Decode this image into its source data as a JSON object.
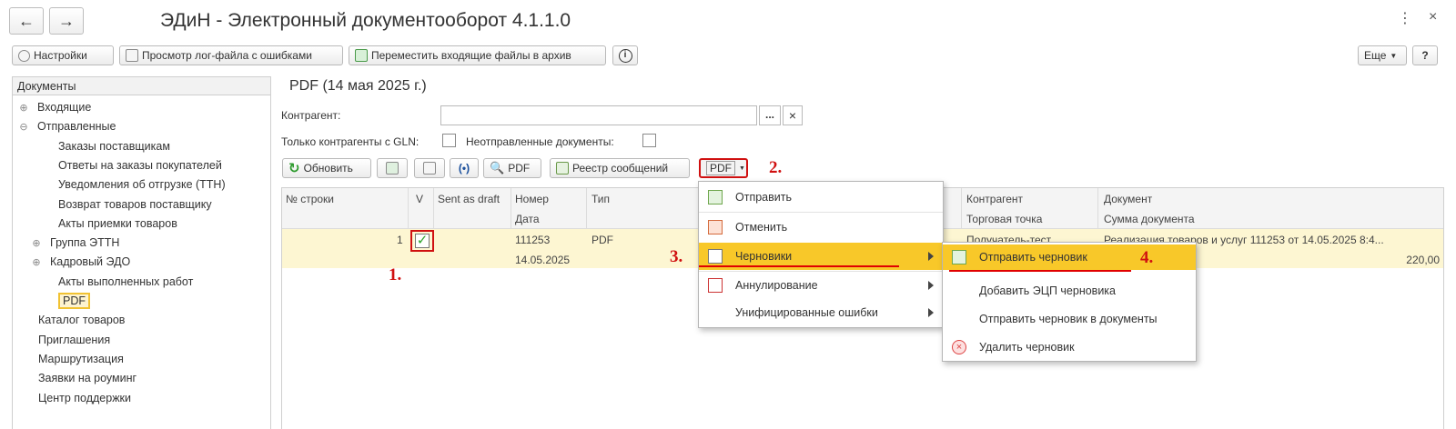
{
  "window": {
    "title": "ЭДиН - Электронный документооборот 4.1.1.0"
  },
  "nav": {
    "back_icon": "arrow-left-icon",
    "forward_icon": "arrow-right-icon"
  },
  "toolbar": {
    "settings": "Настройки",
    "view_log": "Просмотр лог-файла с ошибками",
    "move_archive": "Переместить входящие файлы в архив",
    "more": "Еще",
    "help": "?"
  },
  "sidebar": {
    "header": "Документы",
    "items": [
      {
        "label": "Входящие",
        "glyph": "⊕"
      },
      {
        "label": "Отправленные",
        "glyph": "⊖"
      },
      {
        "label": "Заказы поставщикам"
      },
      {
        "label": "Ответы на заказы покупателей"
      },
      {
        "label": "Уведомления об отгрузке (ТТН)"
      },
      {
        "label": "Возврат товаров поставщику"
      },
      {
        "label": "Акты приемки товаров"
      },
      {
        "label": "Группа ЭТТН",
        "glyph": "⊕"
      },
      {
        "label": "Кадровый ЭДО",
        "glyph": "⊕"
      },
      {
        "label": "Акты выполненных работ"
      },
      {
        "label": "PDF"
      },
      {
        "label": "Каталог товаров"
      },
      {
        "label": "Приглашения"
      },
      {
        "label": "Маршрутизация"
      },
      {
        "label": "Заявки на роуминг"
      },
      {
        "label": "Центр поддержки"
      }
    ]
  },
  "main": {
    "title": "PDF (14 мая 2025 г.)",
    "counterparty_label": "Контрагент:",
    "counterparty_value": "",
    "select_btn": "...",
    "clear_btn": "×",
    "gln_label": "Только контрагенты с GLN:",
    "unsent_label": "Неотправленные документы:",
    "refresh": "Обновить",
    "broadcast": "(•)",
    "pdf_view": "PDF",
    "registry": "Реестр сообщений",
    "pdf_dropdown": "PDF"
  },
  "table": {
    "headers_row1": [
      "№ строки",
      "V",
      "Sent as draft",
      "Номер",
      "Тип",
      "Контрагент",
      "Документ"
    ],
    "headers_row2": [
      "Дата",
      "Торговая точка",
      "Сумма документа"
    ],
    "row": {
      "line_no": "1",
      "number": "111253",
      "date": "14.05.2025",
      "type": "PDF",
      "counterparty": "Получатель-тест",
      "document": "Реализация товаров и услуг 111253 от 14.05.2025 8:4...",
      "amount": "220,00"
    }
  },
  "menu1": {
    "items": [
      "Отправить",
      "Отменить",
      "Черновики",
      "Аннулирование",
      "Унифицированные ошибки"
    ]
  },
  "menu2": {
    "items": [
      "Отправить черновик",
      "Добавить ЭЦП черновика",
      "Отправить черновик в документы",
      "Удалить черновик"
    ]
  },
  "steps": [
    "1.",
    "2.",
    "3.",
    "4."
  ],
  "colors": {
    "selected_row": "#fdf6d2",
    "menu_highlight": "#f8c829",
    "annotation_red": "#d01010",
    "check_green": "#2ca32c"
  }
}
